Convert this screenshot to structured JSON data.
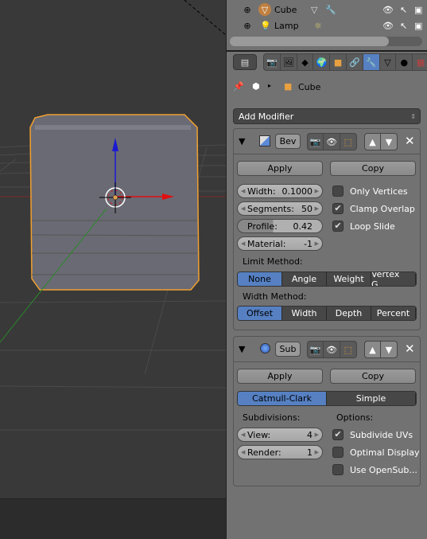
{
  "outliner": {
    "items": [
      {
        "name": "Cube",
        "icons": [
          "mesh-data-icon",
          "wrench-icon"
        ]
      },
      {
        "name": "Lamp",
        "icons": [
          "sun-icon"
        ]
      }
    ]
  },
  "properties": {
    "tabs": [
      "render",
      "render-layers",
      "scene",
      "world",
      "object",
      "constraints",
      "modifiers",
      "data",
      "material",
      "texture"
    ],
    "active_tab": "modifiers",
    "breadcrumb": {
      "object": "Cube"
    },
    "add_modifier": "Add Modifier",
    "accent": "#5680c2"
  },
  "bevel": {
    "name": "Bev",
    "apply": "Apply",
    "copy": "Copy",
    "width_label": "Width:",
    "width": "0.1000",
    "segments_label": "Segments:",
    "segments": "50",
    "profile_label": "Profile:",
    "profile": "0.42",
    "material_label": "Material:",
    "material": "-1",
    "only_vertices": "Only Vertices",
    "only_vertices_checked": false,
    "clamp_overlap": "Clamp Overlap",
    "clamp_overlap_checked": true,
    "loop_slide": "Loop Slide",
    "loop_slide_checked": true,
    "limit_method_label": "Limit Method:",
    "limit_methods": [
      "None",
      "Angle",
      "Weight",
      "Vertex G..."
    ],
    "limit_selected": "None",
    "width_method_label": "Width Method:",
    "width_methods": [
      "Offset",
      "Width",
      "Depth",
      "Percent"
    ],
    "width_selected": "Offset"
  },
  "subsurf": {
    "name": "Sub",
    "apply": "Apply",
    "copy": "Copy",
    "types": [
      "Catmull-Clark",
      "Simple"
    ],
    "type_selected": "Catmull-Clark",
    "subdivisions_label": "Subdivisions:",
    "options_label": "Options:",
    "view_label": "View:",
    "view": "4",
    "render_label": "Render:",
    "render": "1",
    "subdivide_uvs": "Subdivide UVs",
    "subdivide_uvs_checked": true,
    "optimal_display": "Optimal Display",
    "optimal_display_checked": false,
    "use_opensubdiv": "Use OpenSub...",
    "use_opensubdiv_checked": false
  }
}
